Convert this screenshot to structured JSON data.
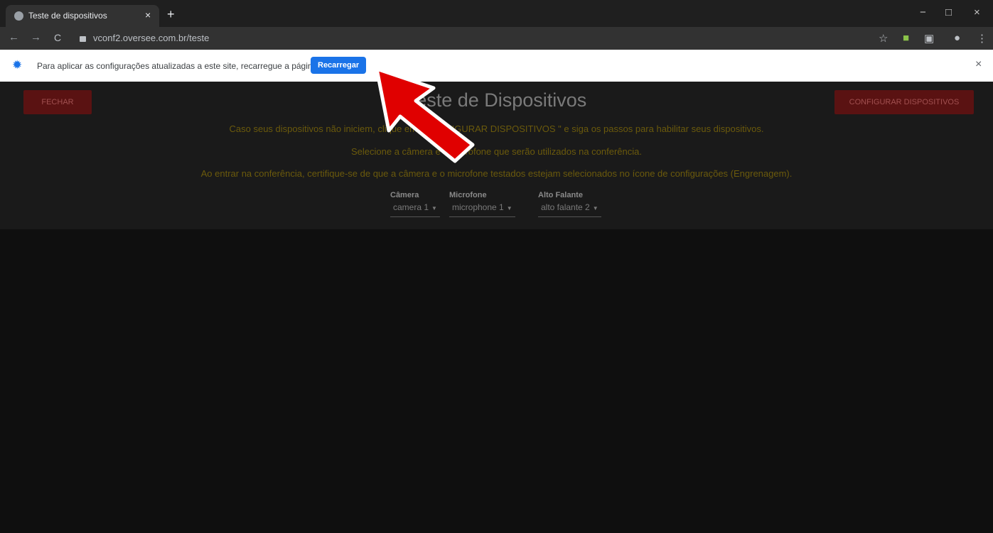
{
  "browser": {
    "tab_title": "Teste de dispositivos",
    "tab_close": "×",
    "new_tab": "+",
    "url": "vconf2.oversee.com.br/teste",
    "nav_back": "←",
    "nav_forward": "→",
    "nav_reload": "C",
    "win_min": "−",
    "win_max": "□",
    "win_close": "×"
  },
  "infobar": {
    "message": "Para aplicar as configurações atualizadas a este site, recarregue a página",
    "reload_label": "Recarregar",
    "close": "×"
  },
  "page": {
    "close_button": "FECHAR",
    "title": "Teste de Dispositivos",
    "config_button": "CONFIGURAR DISPOSITIVOS",
    "instructions": [
      "Caso seus dispositivos não iniciem, clique em \" CONFIGURAR DISPOSITIVOS \" e siga os passos para habilitar seus dispositivos.",
      "Selecione a câmera e o microfone que serão utilizados na conferência.",
      "Ao entrar na conferência, certifique-se de que a câmera e o microfone testados estejam selecionados no ícone de configurações (Engrenagem)."
    ],
    "devices": [
      {
        "label": "Câmera",
        "value": "camera 1"
      },
      {
        "label": "Microfone",
        "value": "microphone 1"
      },
      {
        "label": "Alto Falante",
        "value": "alto falante 2"
      }
    ]
  },
  "colors": {
    "accent_blue": "#1a73e8",
    "button_red": "#5a1212",
    "instruction_text": "#6b5a0c",
    "arrow_red": "#e00000"
  },
  "icons": {
    "favicon": "globe-icon",
    "infobar": "gear-icon",
    "callout": "arrow-icon"
  }
}
